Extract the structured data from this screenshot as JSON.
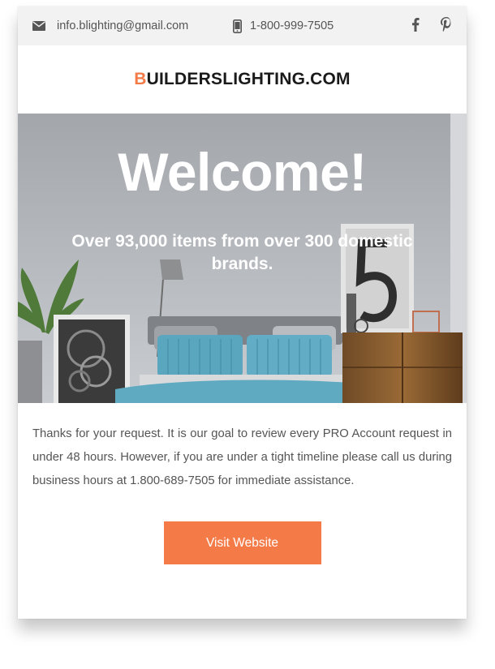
{
  "topbar": {
    "email": "info.blighting@gmail.com",
    "phone": "1-800-999-7505",
    "facebook_glyph": "f",
    "pinterest_glyph": "P"
  },
  "logo": {
    "first_letter": "B",
    "rest": "UILDERSLIGHTING.COM"
  },
  "hero": {
    "title": "Welcome!",
    "subtitle": "Over 93,000 items from over 300 domestic brands."
  },
  "body": {
    "text": "Thanks for your request. It is our goal to review every PRO Account request in under 48 hours. However, if you are under a tight timeline please call us during business hours at 1.800-689-7505 for immediate assistance."
  },
  "cta": {
    "label": "Visit Website"
  },
  "colors": {
    "accent": "#f47b48",
    "topbar_bg": "#f2f2f2",
    "text": "#555555"
  },
  "icons": [
    "envelope-icon",
    "phone-icon",
    "facebook-icon",
    "pinterest-icon"
  ]
}
